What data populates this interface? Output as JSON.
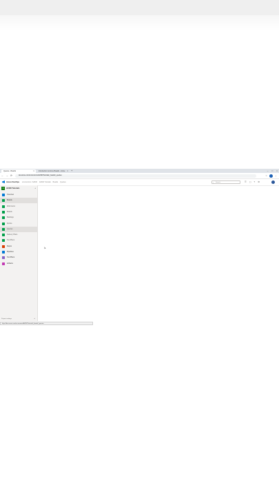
{
  "browser": {
    "tabs": [
      {
        "title": "Queries - Boards",
        "close": "×"
      },
      {
        "title": "Introduction to Azure Boards - Azure",
        "close": "×"
      }
    ],
    "new_tab": "+",
    "window_controls": [
      "–",
      "□",
      "×"
    ],
    "nav": [
      "←",
      "→",
      "⟳"
    ],
    "url": "dev.azure.com/scrumcomm/AZ400Tutorials/_boards/_queries",
    "toolbar_icons": [
      "☆",
      "⋮"
    ]
  },
  "header": {
    "brand": "Azure DevOps",
    "breadcrumbs": [
      "scrumcomm / AZ400",
      "AZ400 Tutorials",
      "Boards",
      "Queries"
    ],
    "search_placeholder": "Search"
  },
  "sidebar": {
    "project_badge": "A",
    "project_name": "AZ400 Tutorials",
    "project_add": "+",
    "items": [
      {
        "label": "Overview",
        "color": "#0078d4",
        "sub": false,
        "highlight": false
      },
      {
        "label": "Boards",
        "color": "#009e49",
        "sub": false,
        "highlight": true
      },
      {
        "label": "Work items",
        "color": "#009e49",
        "sub": true,
        "highlight": false
      },
      {
        "label": "Boards",
        "color": "#009e49",
        "sub": true,
        "highlight": false
      },
      {
        "label": "Backlogs",
        "color": "#009e49",
        "sub": true,
        "highlight": false
      },
      {
        "label": "Sprints",
        "color": "#009e49",
        "sub": true,
        "highlight": false
      },
      {
        "label": "Queries",
        "color": "#009e49",
        "sub": true,
        "highlight": true
      },
      {
        "label": "Delivery Plans",
        "color": "#009e49",
        "sub": true,
        "highlight": false
      },
      {
        "label": "Test Plans",
        "color": "#009e49",
        "sub": true,
        "highlight": false
      },
      {
        "label": "Repos",
        "color": "#d83b01",
        "sub": false,
        "highlight": false
      },
      {
        "label": "Pipelines",
        "color": "#0078d4",
        "sub": false,
        "highlight": false
      },
      {
        "label": "Test Plans",
        "color": "#8661c5",
        "sub": false,
        "highlight": false
      },
      {
        "label": "Artifacts",
        "color": "#c239b3",
        "sub": false,
        "highlight": false
      }
    ],
    "footer": "Project settings",
    "collapse": "«"
  },
  "status_bar": "https://dev.azure.com/scrumcomm/AZ400Tutorials/_boards/_queries"
}
